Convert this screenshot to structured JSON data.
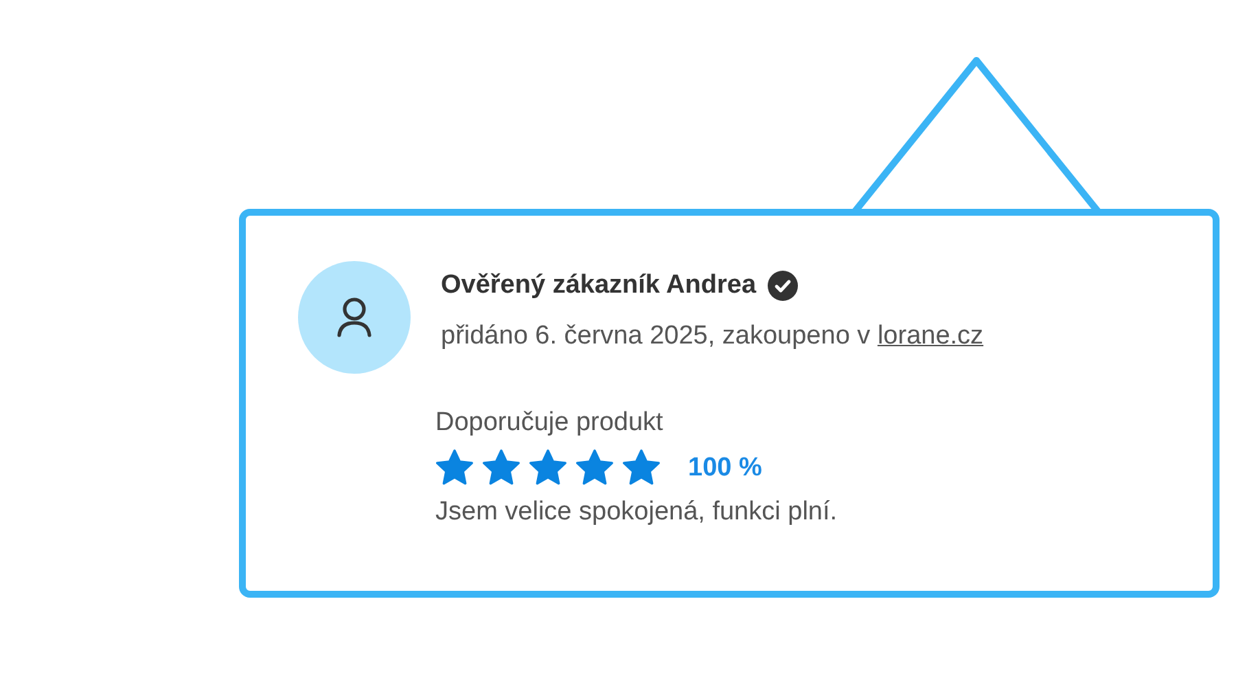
{
  "review": {
    "author": "Ověřený zákazník Andrea",
    "verified": true,
    "meta": "přidáno 6. června 2025, zakoupeno v",
    "shop_link": "lorane.cz",
    "recommendation": "Doporučuje produkt",
    "stars": 5,
    "percent": "100 %",
    "text": "Jsem velice spokojená, funkci plní."
  }
}
